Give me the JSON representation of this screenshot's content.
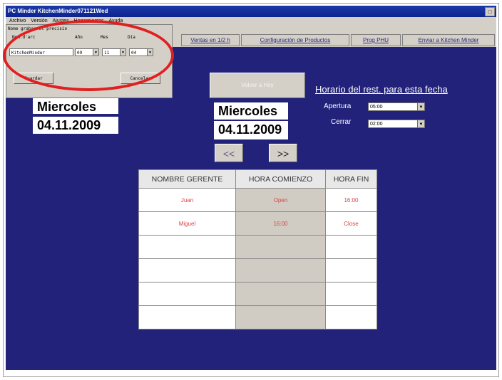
{
  "window": {
    "title": "PC Minder KitchenMinder071121Wed",
    "max_btn": "□"
  },
  "menu": [
    "Archivo",
    "Versión",
    "Ajustes",
    "Herramientas",
    "Ayuda"
  ],
  "tabs": [
    "Ventas en 1/2 h",
    "Configuración de Productos",
    "Prog PHU",
    "Enviar a Kitchen Minder"
  ],
  "dialog": {
    "heading": "Nome grabar al precisio",
    "col_nom": "Nom.d'arc",
    "col_ano": "Año",
    "col_mes": "Mes",
    "col_dia": "Día",
    "nom_value": "KitchenMinder",
    "ano_value": "09",
    "mes_value": "11",
    "dia_value": "04",
    "save_label": "Guardar",
    "cancel_label": "Cancelar"
  },
  "left_date": {
    "weekday": "Miercoles",
    "date": "04.11.2009"
  },
  "center_date": {
    "today_button": "Volver a Hoy",
    "weekday": "Miercoles",
    "date": "04.11.2009",
    "prev": "<<",
    "next": ">>"
  },
  "schedule": {
    "title": "Horario del rest. para esta fecha",
    "open_label": "Apertura",
    "open_value": "05:00",
    "close_label": "Cerrar",
    "close_value": "02:00"
  },
  "table": {
    "headers": [
      "NOMBRE GERENTE",
      "HORA COMIENZO",
      "HORA FIN"
    ],
    "rows": [
      [
        "Juan",
        "Open",
        "16:00"
      ],
      [
        "Miguel",
        "16:00",
        "Close"
      ],
      [
        "",
        "",
        ""
      ],
      [
        "",
        "",
        ""
      ],
      [
        "",
        "",
        ""
      ],
      [
        "",
        "",
        ""
      ]
    ]
  },
  "colors": {
    "background": "#22227a",
    "accent": "#e02020",
    "entry_text": "#d84545"
  },
  "icons": {
    "dropdown_arrow": "chevron-down-icon"
  }
}
